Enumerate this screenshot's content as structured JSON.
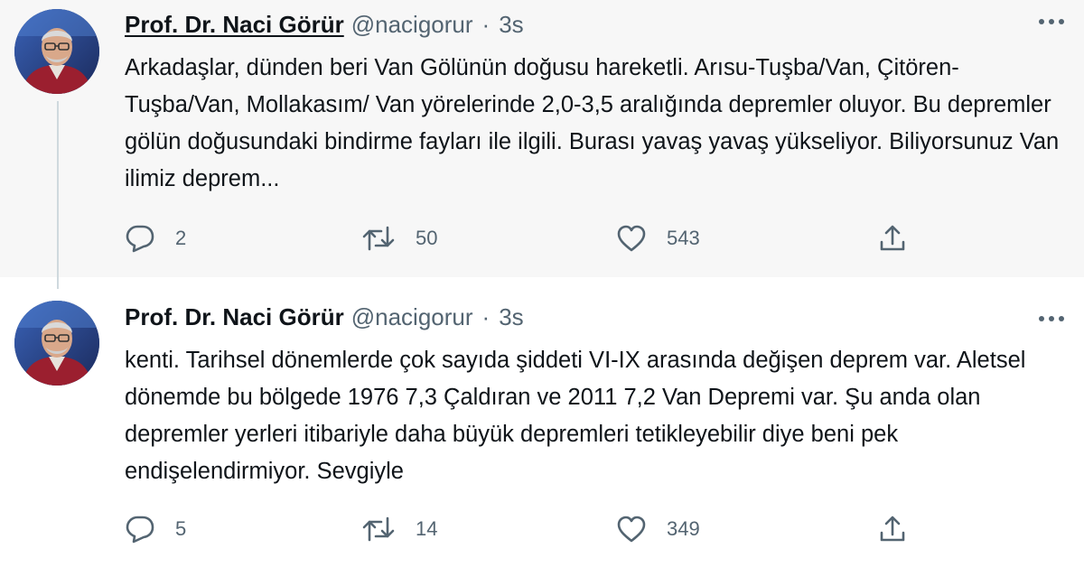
{
  "tweets": [
    {
      "author_name": "Prof. Dr. Naci Görür",
      "handle": "@nacigorur",
      "separator": "·",
      "time": "3s",
      "text": "Arkadaşlar, dünden beri Van Gölünün doğusu hareketli. Arısu-Tuşba/Van, Çitören-Tuşba/Van, Mollakasım/ Van yörelerinde 2,0-3,5 aralığında depremler oluyor. Bu depremler gölün doğusundaki bindirme fayları ile ilgili. Burası yavaş yavaş yükseliyor. Biliyorsunuz Van ilimiz deprem...",
      "reply_count": "2",
      "retweet_count": "50",
      "like_count": "543"
    },
    {
      "author_name": "Prof. Dr. Naci Görür",
      "handle": "@nacigorur",
      "separator": "·",
      "time": "3s",
      "text": "kenti. Tarihsel dönemlerde çok sayıda şiddeti VI-IX arasında değişen deprem var. Aletsel dönemde bu bölgede 1976 7,3 Çaldıran ve 2011 7,2 Van Depremi var. Şu anda olan depremler yerleri itibariyle daha büyük depremleri tetikleyebilir diye beni pek endişelendirmiyor. Sevgiyle",
      "reply_count": "5",
      "retweet_count": "14",
      "like_count": "349"
    }
  ],
  "icons": {
    "reply": "reply-icon",
    "retweet": "retweet-icon",
    "like": "heart-icon",
    "share": "share-icon",
    "more": "more-options-icon"
  },
  "colors": {
    "text": "#0f1419",
    "secondary": "#536471",
    "highlight_background": "#f7f7f7",
    "thread_line": "#cfd9de"
  }
}
